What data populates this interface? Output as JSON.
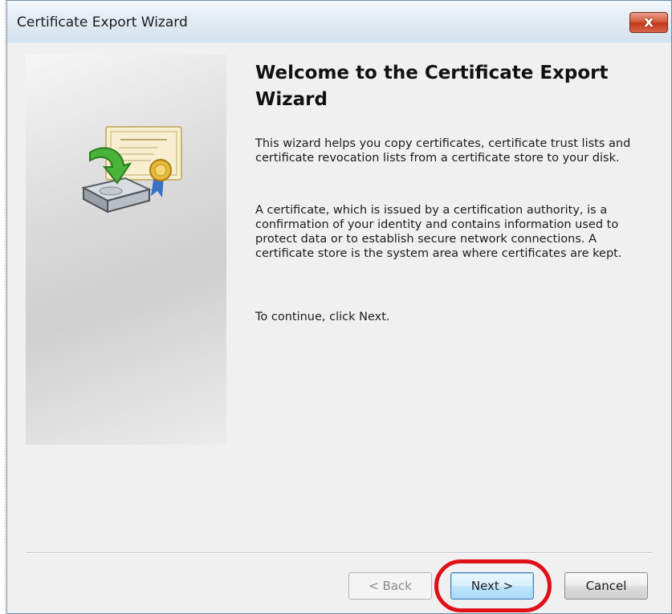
{
  "window": {
    "title": "Certificate Export Wizard",
    "close_label": "x"
  },
  "content": {
    "heading": "Welcome to the Certificate Export Wizard",
    "paragraphs": [
      "This wizard helps you copy certificates, certificate trust lists and certificate revocation lists from a certificate store to your disk.",
      "A certificate, which is issued by a certification authority, is a confirmation of your identity and contains information used to protect data or to establish secure network connections. A certificate store is the system area where certificates are kept.",
      "To continue, click Next."
    ]
  },
  "buttons": {
    "back": "< Back",
    "next": "Next >",
    "cancel": "Cancel"
  },
  "icons": {
    "wizard_graphic": "certificate-export-icon",
    "close": "close-icon"
  },
  "colors": {
    "highlight": "#e0101a",
    "close_button": "#c8462a",
    "next_button_border": "#3c7fb1"
  }
}
